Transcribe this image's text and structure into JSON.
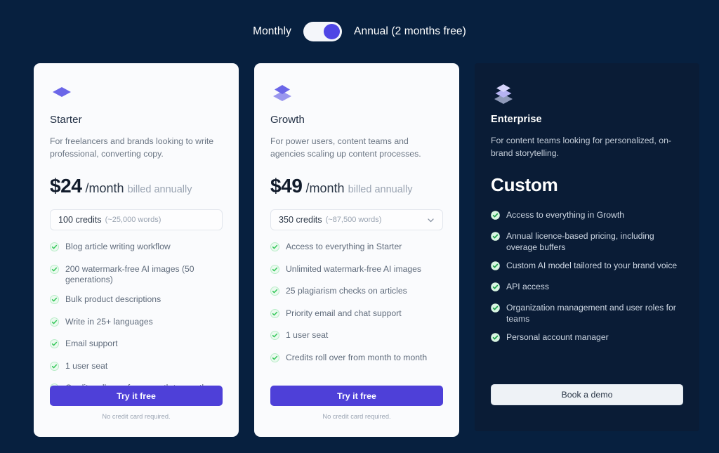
{
  "billing_toggle": {
    "monthly_label": "Monthly",
    "annual_label": "Annual (2 months free)",
    "selected": "annual"
  },
  "colors": {
    "page_background": "#07203f",
    "card_light_background": "#fafbfd",
    "card_dark_background": "#0a1c36",
    "accent_purple": "#4e40d8",
    "toggle_knob": "#4f46e5",
    "check_green": "#34c759",
    "icon_purple": "#6b66e8"
  },
  "plans": [
    {
      "icon": "single-diamond-icon",
      "name": "Starter",
      "description": "For freelancers and brands looking to write professional, converting copy.",
      "price_amount": "$24",
      "price_period": "/month",
      "price_note": "billed annually",
      "credits_main": "100 credits",
      "credits_sub": "(~25,000 words)",
      "has_dropdown": false,
      "features": [
        "Blog article writing workflow",
        "200 watermark-free AI images (50 generations)",
        "Bulk product descriptions",
        "Write in 25+ languages",
        "Email support",
        "1 user seat",
        "Credits roll over from month to month"
      ],
      "cta_label": "Try it free",
      "cta_note": "No credit card required."
    },
    {
      "icon": "double-stack-icon",
      "name": "Growth",
      "description": "For power users, content teams and agencies scaling up content processes.",
      "price_amount": "$49",
      "price_period": "/month",
      "price_note": "billed annually",
      "credits_main": "350 credits",
      "credits_sub": "(~87,500 words)",
      "has_dropdown": true,
      "features": [
        "Access to everything in Starter",
        "Unlimited watermark-free AI images",
        "25 plagiarism checks on articles",
        "Priority email and chat support",
        "1 user seat",
        "Credits roll over from month to month"
      ],
      "cta_label": "Try it free",
      "cta_note": "No credit card required."
    },
    {
      "icon": "triple-stack-icon",
      "name": "Enterprise",
      "description": "For content teams looking for personalized, on-brand storytelling.",
      "price_custom": "Custom",
      "features": [
        "Access to everything in Growth",
        "Annual licence-based pricing, including overage buffers",
        "Custom AI model tailored to your brand voice",
        "API access",
        "Organization management and user roles for teams",
        "Personal account manager"
      ],
      "cta_label": "Book a demo"
    }
  ]
}
